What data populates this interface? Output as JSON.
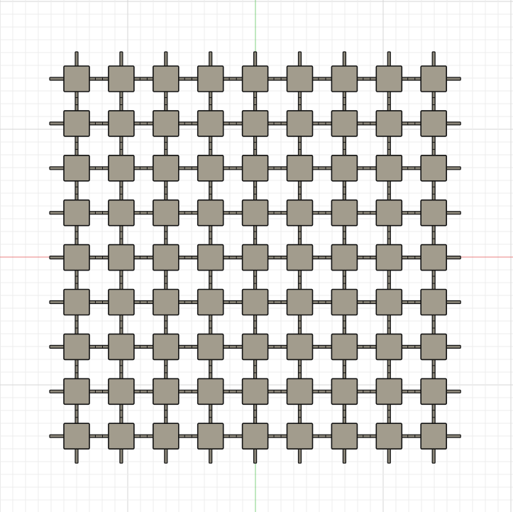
{
  "viewport": {
    "background": "#ffffff",
    "grid_minor_color": "#ececec",
    "grid_major_color": "#d6d6d6",
    "x_axis_color": "#e88080",
    "y_axis_color": "#80d080"
  },
  "array": {
    "rows": 9,
    "columns": 9,
    "pad_fill": "#a29c8d",
    "outline": "#111111",
    "connector_fill": "#8a8578"
  }
}
